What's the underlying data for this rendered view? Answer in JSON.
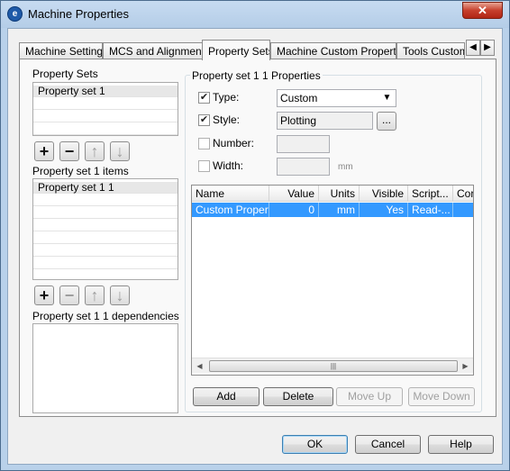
{
  "window": {
    "title": "Machine Properties",
    "close_glyph": "✕",
    "app_icon_glyph": "e"
  },
  "tabs": [
    {
      "label": "Machine Settings"
    },
    {
      "label": "MCS and Alignment"
    },
    {
      "label": "Property Sets"
    },
    {
      "label": "Machine Custom Properties"
    },
    {
      "label": "Tools Custom F"
    }
  ],
  "tab_scroll": {
    "left": "◀",
    "right": "▶"
  },
  "property_sets": {
    "heading": "Property Sets",
    "items": [
      "Property set 1"
    ],
    "buttons": {
      "add": "+",
      "remove": "−",
      "up": "↑",
      "down": "↓"
    }
  },
  "items": {
    "heading": "Property set 1 items",
    "items": [
      "Property set 1 1"
    ],
    "buttons": {
      "add": "+",
      "remove": "−",
      "up": "↑",
      "down": "↓"
    }
  },
  "dependencies": {
    "heading": "Property set 1 1 dependencies"
  },
  "props": {
    "group_title": "Property set 1 1 Properties",
    "type": {
      "label": "Type:",
      "checked_glyph": "✔",
      "value": "Custom",
      "arrow": "▼"
    },
    "style": {
      "label": "Style:",
      "checked_glyph": "✔",
      "value": "Plotting",
      "ellipsis": "..."
    },
    "number": {
      "label": "Number:",
      "value": ""
    },
    "width": {
      "label": "Width:",
      "value": "",
      "unit": "mm"
    }
  },
  "grid": {
    "columns": [
      "Name",
      "Value",
      "Units",
      "Visible",
      "Script...",
      "Cor"
    ],
    "rows": [
      {
        "name": "Custom Property",
        "value": "0",
        "units": "mm",
        "visible": "Yes",
        "script": "Read-...",
        "cor": ""
      }
    ],
    "scroll": {
      "left": "◀",
      "right": "▶",
      "grip": "|||"
    }
  },
  "grid_buttons": {
    "add": "Add",
    "delete": "Delete",
    "move_up": "Move Up",
    "move_down": "Move Down"
  },
  "footer": {
    "ok": "OK",
    "cancel": "Cancel",
    "help": "Help"
  }
}
